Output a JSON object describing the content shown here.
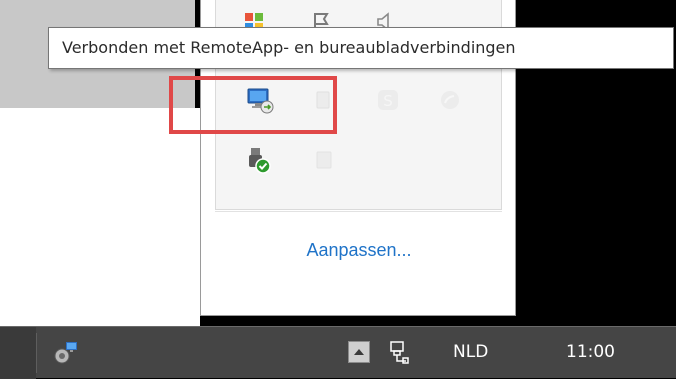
{
  "tooltip": {
    "text": "Verbonden met RemoteApp- en bureaubladverbindingen"
  },
  "flyout": {
    "customize_label": "Aanpassen...",
    "icons": [
      {
        "name": "windows-flag-icon"
      },
      {
        "name": "flag-outline-icon"
      },
      {
        "name": "speaker-outline-icon"
      },
      {
        "name": "remoteapp-connection-icon"
      },
      {
        "name": "faded-tray-icon"
      },
      {
        "name": "skype-faded-icon"
      },
      {
        "name": "feed-faded-icon"
      },
      {
        "name": "safely-remove-hardware-icon"
      },
      {
        "name": "faded-tray-icon"
      }
    ]
  },
  "taskbar": {
    "language": "NLD",
    "clock": "11:00",
    "show_hidden_icon": "triangle-up-icon",
    "network_icon": "network-icon",
    "pinned_icon": "remote-desktop-app-icon"
  },
  "colors": {
    "highlight": "#e04848",
    "link": "#1f73c8",
    "taskbar": "#454545"
  }
}
